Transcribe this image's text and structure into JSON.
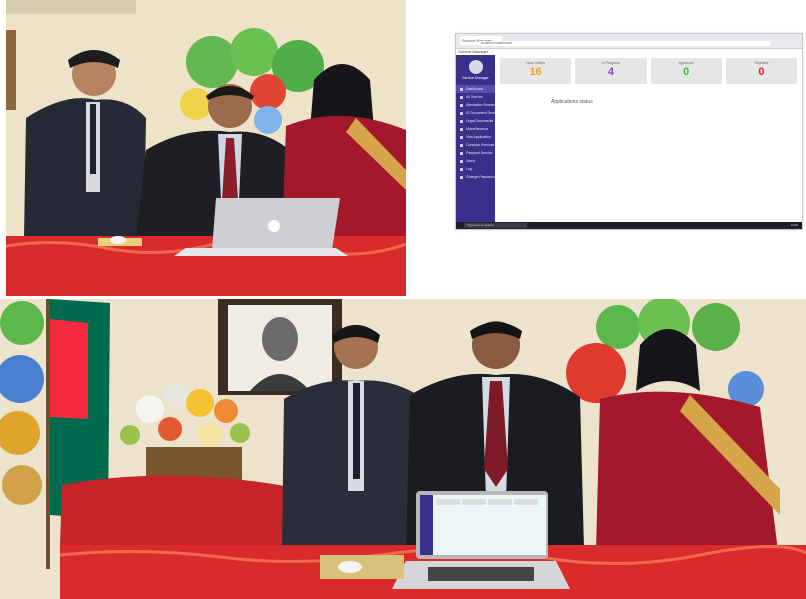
{
  "dashboard": {
    "tab_title": "Service Manager",
    "url": "localhost/dashboard",
    "app_title": "Service Manager",
    "sidebar_caption": "Service Manager",
    "menu": [
      "Dashboard",
      "All Service",
      "Attestation Service",
      "ID Document Service",
      "Legal Documents",
      "Miscellaneous",
      "Visa Application",
      "Consular Services",
      "Passport Service",
      "Users",
      "Log",
      "Change Password"
    ],
    "cards": [
      {
        "label": "New Orders",
        "value": "16",
        "color": "#f0a020"
      },
      {
        "label": "In Progress",
        "value": "4",
        "color": "#9b3fc4"
      },
      {
        "label": "Approved",
        "value": "0",
        "color": "#3fbf3f"
      },
      {
        "label": "Rejected",
        "value": "0",
        "color": "#e02020"
      }
    ],
    "main_text": "Applications status",
    "taskbar_search": "Type here to search",
    "taskbar_clock": "12:00"
  },
  "colors": {
    "sidebar": "#3b2f8c",
    "tablecloth": "#d92b2b",
    "balloon_green": "#5cb84a",
    "balloon_red": "#e03a2f",
    "balloon_blue": "#4a7fd0",
    "flag_green": "#006a4e",
    "flag_red": "#f42a41"
  }
}
